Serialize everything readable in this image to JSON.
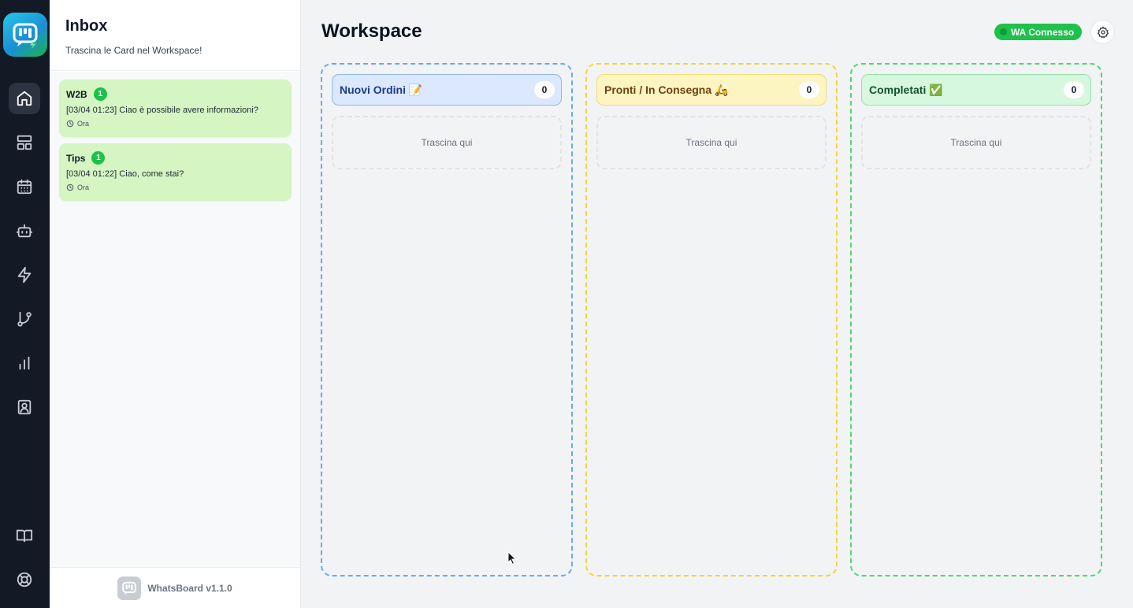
{
  "sidebar": {
    "logo_icon": "whatsboard-logo-icon",
    "nav": [
      {
        "icon": "home-icon",
        "active": true
      },
      {
        "icon": "layout-icon"
      },
      {
        "icon": "calendar-icon"
      },
      {
        "icon": "bot-icon"
      },
      {
        "icon": "lightning-icon"
      },
      {
        "icon": "git-branch-icon"
      },
      {
        "icon": "bar-chart-icon"
      },
      {
        "icon": "contact-icon"
      }
    ],
    "bottom": [
      {
        "icon": "book-icon"
      },
      {
        "icon": "help-icon"
      }
    ]
  },
  "inbox": {
    "title": "Inbox",
    "subtitle": "Trascina le Card nel Workspace!",
    "chats": [
      {
        "name": "W2B",
        "unread": "1",
        "message": "[03/04 01:23] Ciao è possibile avere informazioni?",
        "time": "Ora"
      },
      {
        "name": "Tips",
        "unread": "1",
        "message": "[03/04 01:22] Ciao, come stai?",
        "time": "Ora"
      }
    ],
    "footer": "WhatsBoard v1.1.0"
  },
  "workspace": {
    "title": "Workspace",
    "status": "WA Connesso",
    "colors": {
      "status": "#1ec14b",
      "blue": "#6aa9e8",
      "yellow": "#f7d33c",
      "green": "#4fd86b"
    },
    "columns": [
      {
        "title": "Nuovi Ordini 📝",
        "count": "0",
        "drop_text": "Trascina qui"
      },
      {
        "title": "Pronti / In Consegna 🛵",
        "count": "0",
        "drop_text": "Trascina qui"
      },
      {
        "title": "Completati ✅",
        "count": "0",
        "drop_text": "Trascina qui"
      }
    ]
  }
}
